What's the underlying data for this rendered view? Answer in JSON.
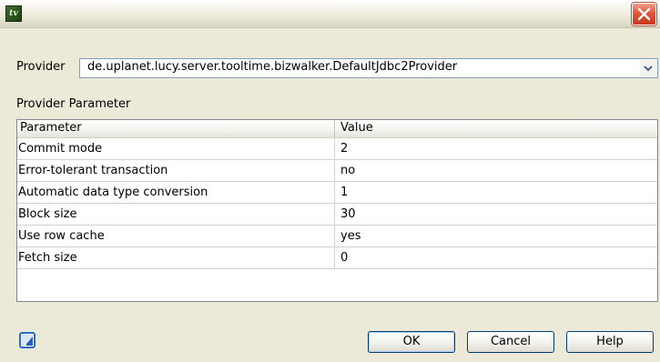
{
  "window": {
    "app_icon_text": "tv",
    "colors": {
      "title_close": "#e0563a",
      "field_border": "#7f9db9"
    }
  },
  "provider": {
    "label": "Provider",
    "selected": "de.uplanet.lucy.server.tooltime.bizwalker.DefaultJdbc2Provider"
  },
  "params": {
    "section_label": "Provider Parameter",
    "columns": [
      "Parameter",
      "Value"
    ],
    "rows": [
      {
        "name": "Commit mode",
        "value": "2"
      },
      {
        "name": "Error-tolerant transaction",
        "value": "no"
      },
      {
        "name": "Automatic data type conversion",
        "value": "1"
      },
      {
        "name": "Block size",
        "value": "30"
      },
      {
        "name": "Use row cache",
        "value": "yes"
      },
      {
        "name": "Fetch size",
        "value": "0"
      }
    ]
  },
  "buttons": {
    "ok": "OK",
    "cancel": "Cancel",
    "help": "Help"
  },
  "icons": {
    "app": "app-icon",
    "close": "close-icon",
    "dropdown": "chevron-down-icon",
    "status": "checkbox-icon"
  }
}
